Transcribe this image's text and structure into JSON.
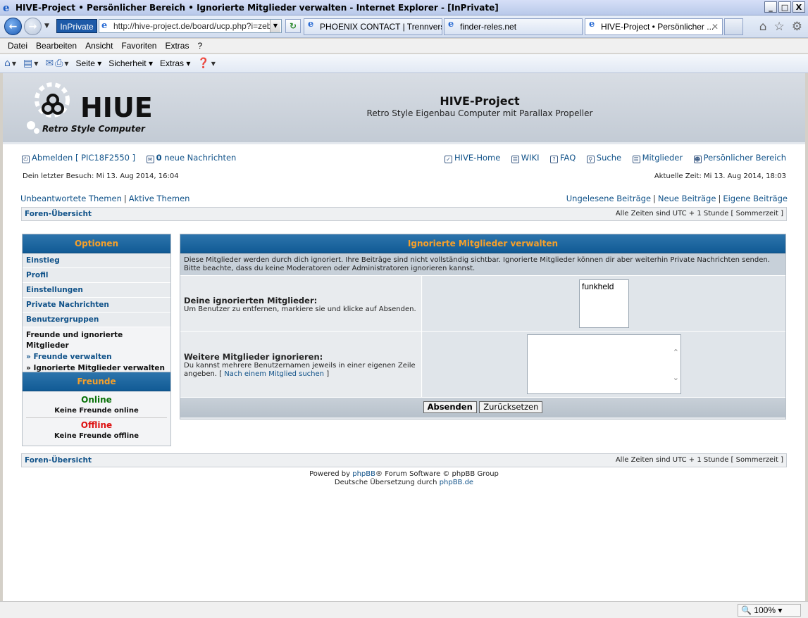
{
  "window": {
    "title": "HIVE-Project • Persönlicher Bereich • Ignorierte Mitglieder verwalten - Internet Explorer - [InPrivate]",
    "minimize": "_",
    "maximize": "□",
    "close": "X"
  },
  "browser": {
    "inprivate": "InPrivate",
    "address": "http://hive-project.de/board/ucp.php?i=zebr",
    "tabs": [
      {
        "label": "PHOENIX CONTACT | Trennvers..."
      },
      {
        "label": "finder-reles.net"
      },
      {
        "label": "HIVE-Project • Persönlicher ..."
      }
    ],
    "menu": [
      "Datei",
      "Bearbeiten",
      "Ansicht",
      "Favoriten",
      "Extras",
      "?"
    ],
    "commands": [
      "Seite",
      "Sicherheit",
      "Extras"
    ],
    "zoom": "100%"
  },
  "header": {
    "title": "HIVE-Project",
    "subtitle": "Retro Style Eigenbau Computer mit Parallax Propeller",
    "logo_text": "HIUE",
    "logo_sub": "Retro Style Computer"
  },
  "topmenu": {
    "logout": "Abmelden [ PIC18F2550 ]",
    "new_count": "0",
    "new_messages": "neue Nachrichten",
    "home": "HIVE-Home",
    "wiki": "WIKI",
    "faq": "FAQ",
    "search": "Suche",
    "members": "Mitglieder",
    "ucp": "Persönlicher Bereich"
  },
  "info": {
    "last_visit": "Dein letzter Besuch: Mi 13. Aug 2014, 16:04",
    "current_time": "Aktuelle Zeit: Mi 13. Aug 2014, 18:03"
  },
  "subnav": {
    "unanswered": "Unbeantwortete Themen",
    "active": "Aktive Themen",
    "unread": "Ungelesene Beiträge",
    "new": "Neue Beiträge",
    "own": "Eigene Beiträge"
  },
  "breadcrumb": {
    "forum_index": "Foren-Übersicht",
    "timezone": "Alle Zeiten sind UTC + 1 Stunde [ Sommerzeit ]"
  },
  "sidebar": {
    "options_title": "Optionen",
    "items": [
      "Einstieg",
      "Profil",
      "Einstellungen",
      "Private Nachrichten",
      "Benutzergruppen"
    ],
    "group_title": "Freunde und ignorierte Mitglieder",
    "sub_friends": "» Freunde verwalten",
    "sub_foes": "» Ignorierte Mitglieder verwalten",
    "friends_title": "Freunde",
    "online": "Online",
    "no_online": "Keine Freunde online",
    "offline": "Offline",
    "no_offline": "Keine Freunde offline"
  },
  "main": {
    "title": "Ignorierte Mitglieder verwalten",
    "intro": "Diese Mitglieder werden durch dich ignoriert. Ihre Beiträge sind nicht vollständig sichtbar. Ignorierte Mitglieder können dir aber weiterhin Private Nachrichten senden. Bitte beachte, dass du keine Moderatoren oder Administratoren ignorieren kannst.",
    "ignored_label": "Deine ignorierten Mitglieder:",
    "ignored_desc": "Um Benutzer zu entfernen, markiere sie und klicke auf Absenden.",
    "ignored_list": [
      "funkheld"
    ],
    "add_label": "Weitere Mitglieder ignorieren:",
    "add_desc": "Du kannst mehrere Benutzernamen jeweils in einer eigenen Zeile angeben. [",
    "add_link": "Nach einem Mitglied suchen",
    "add_desc_end": "]",
    "submit": "Absenden",
    "reset": "Zurücksetzen"
  },
  "footer": {
    "powered_prefix": "Powered by",
    "phpbb": "phpBB",
    "powered_suffix": "® Forum Software © phpBB Group",
    "translation_prefix": "Deutsche Übersetzung durch",
    "translation_link": "phpBB.de"
  }
}
